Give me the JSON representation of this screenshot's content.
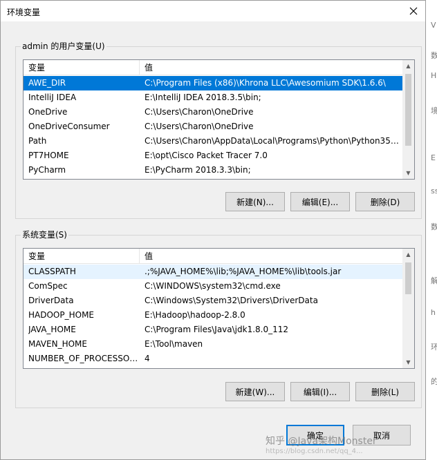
{
  "window": {
    "title": "环境变量"
  },
  "user_vars": {
    "group_label": "admin 的用户变量(U)",
    "col_name": "变量",
    "col_value": "值",
    "rows": [
      {
        "name": "AWE_DIR",
        "value": "C:\\Program Files (x86)\\Khrona LLC\\Awesomium SDK\\1.6.6\\",
        "selected": true
      },
      {
        "name": "IntelliJ IDEA",
        "value": "E:\\IntelliJ IDEA 2018.3.5\\bin;"
      },
      {
        "name": "OneDrive",
        "value": "C:\\Users\\Charon\\OneDrive"
      },
      {
        "name": "OneDriveConsumer",
        "value": "C:\\Users\\Charon\\OneDrive"
      },
      {
        "name": "Path",
        "value": "C:\\Users\\Charon\\AppData\\Local\\Programs\\Python\\Python35\\..."
      },
      {
        "name": "PT7HOME",
        "value": "E:\\opt\\Cisco Packet Tracer 7.0"
      },
      {
        "name": "PyCharm",
        "value": "E:\\PyCharm 2018.3.3\\bin;"
      }
    ],
    "buttons": {
      "new": "新建(N)...",
      "edit": "编辑(E)...",
      "delete": "删除(D)"
    }
  },
  "system_vars": {
    "group_label": "系统变量(S)",
    "col_name": "变量",
    "col_value": "值",
    "rows": [
      {
        "name": "CLASSPATH",
        "value": ".;%JAVA_HOME%\\lib;%JAVA_HOME%\\lib\\tools.jar",
        "hover": true
      },
      {
        "name": "ComSpec",
        "value": "C:\\WINDOWS\\system32\\cmd.exe"
      },
      {
        "name": "DriverData",
        "value": "C:\\Windows\\System32\\Drivers\\DriverData"
      },
      {
        "name": "HADOOP_HOME",
        "value": "E:\\Hadoop\\hadoop-2.8.0"
      },
      {
        "name": "JAVA_HOME",
        "value": "C:\\Program Files\\Java\\jdk1.8.0_112"
      },
      {
        "name": "MAVEN_HOME",
        "value": "E:\\Tool\\maven"
      },
      {
        "name": "NUMBER_OF_PROCESSORS",
        "value": "4"
      }
    ],
    "buttons": {
      "new": "新建(W)...",
      "edit": "编辑(I)...",
      "delete": "删除(L)"
    }
  },
  "footer": {
    "ok": "确定",
    "cancel": "取消"
  },
  "watermark": {
    "text": "知乎 @Java架构Monster",
    "sub": "https://blog.csdn.net/qq_4..."
  },
  "background_chars": [
    "V",
    "数",
    "H",
    "境",
    "E",
    "ss",
    "数",
    "解",
    "h",
    "环",
    "的"
  ],
  "colors": {
    "selection": "#0078d7",
    "hover": "#e5f3ff",
    "default_button_border": "#0078d7"
  }
}
